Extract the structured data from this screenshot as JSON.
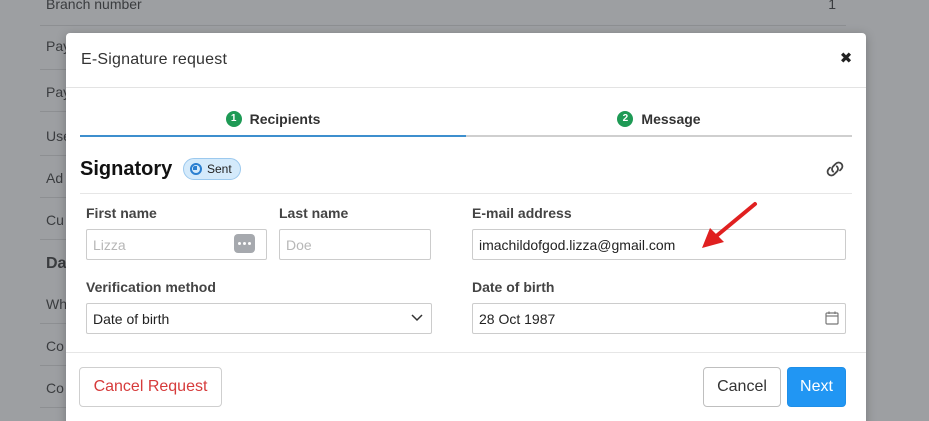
{
  "background": {
    "rows": [
      {
        "label": "Branch number",
        "value": "1"
      },
      {
        "label": "Pay",
        "value": ""
      },
      {
        "label": "Pay",
        "value": ""
      },
      {
        "label": "Use",
        "value": ""
      },
      {
        "label": "Ad",
        "value": ""
      },
      {
        "label": "Cu",
        "value": ""
      },
      {
        "label": "Da",
        "value": ""
      },
      {
        "label": "Wh",
        "value": ""
      },
      {
        "label": "Co",
        "value": ""
      },
      {
        "label": "Co",
        "value": ""
      }
    ]
  },
  "modal": {
    "title": "E-Signature request",
    "close_icon": "close-icon"
  },
  "steps": [
    {
      "number": "1",
      "label": "Recipients",
      "active": true
    },
    {
      "number": "2",
      "label": "Message",
      "active": false
    }
  ],
  "signatory": {
    "title": "Signatory",
    "status": "Sent",
    "link_icon": "link-icon"
  },
  "form": {
    "first_name": {
      "label": "First name",
      "placeholder": "Lizza",
      "value": ""
    },
    "last_name": {
      "label": "Last name",
      "placeholder": "Doe",
      "value": ""
    },
    "email": {
      "label": "E-mail address",
      "value": "imachildofgod.lizza@gmail.com"
    },
    "verification": {
      "label": "Verification method",
      "selected": "Date of birth"
    },
    "dob": {
      "label": "Date of birth",
      "value": "28 Oct 1987"
    }
  },
  "footer": {
    "cancel_request": "Cancel Request",
    "cancel": "Cancel",
    "next": "Next"
  },
  "colors": {
    "accent": "#2196f3",
    "step_done": "#1e9a55",
    "danger": "#d63b3b",
    "arrow": "#e02020"
  }
}
